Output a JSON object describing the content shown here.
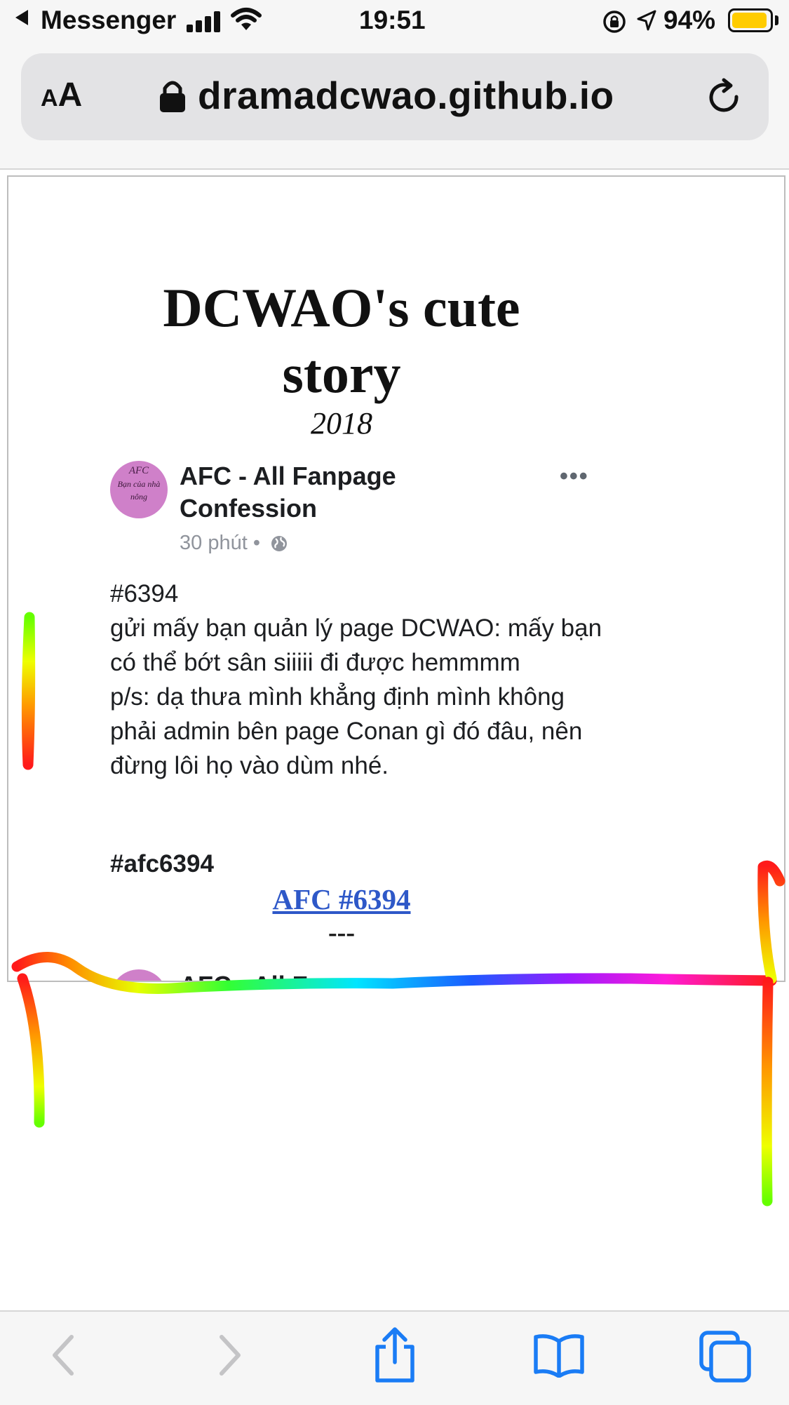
{
  "status_bar": {
    "back_app": "Messenger",
    "time": "19:51",
    "battery_percent": "94%",
    "battery_level": 0.94,
    "battery_color": "#ffcc00"
  },
  "address_bar": {
    "text_size_small": "A",
    "text_size_big": "A",
    "url": "dramadcwao.github.io"
  },
  "page": {
    "title": "DCWAO's cute story",
    "year": "2018",
    "post": {
      "avatar_text": [
        "AFC",
        "Bạn của nhà",
        "nông"
      ],
      "page_name": "AFC - All Fanpage Confession",
      "more": "•••",
      "meta": "30 phút •",
      "body": "#6394\ngửi mấy bạn quản lý page DCWAO: mấy bạn có thể bớt sân siiiii đi được hemmmm\np/s: dạ thưa mình khẳng định mình không phải admin bên page Conan gì đó đâu, nên đừng lôi họ vào dùm nhé.",
      "hashtag": "#afc6394"
    },
    "link_text": "AFC #6394",
    "separator": "---",
    "next_post_name": "AFC - All Fanpage"
  },
  "colors": {
    "link": "#2e58c8",
    "ios_blue": "#1a7cf5",
    "disabled": "#c4c4c6",
    "avatar": "#cf80c9"
  },
  "toolbar": {
    "buttons": [
      "back-icon",
      "forward-icon",
      "share-icon",
      "bookmarks-icon",
      "tabs-icon"
    ]
  }
}
